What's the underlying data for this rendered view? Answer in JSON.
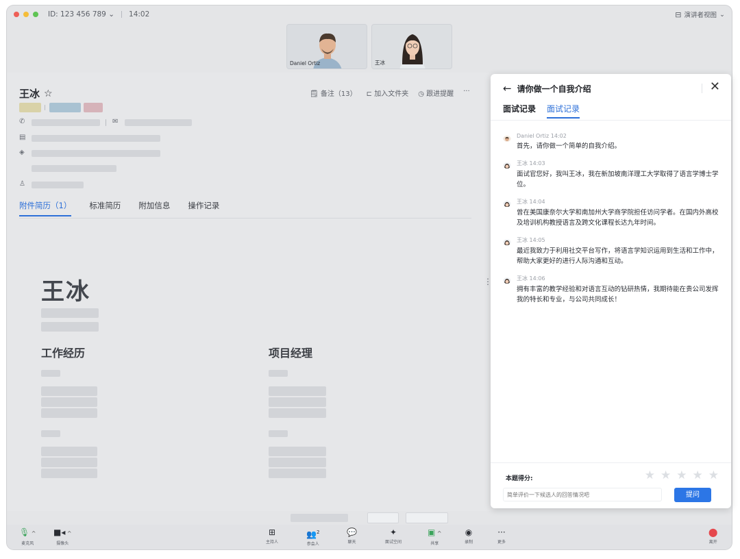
{
  "topbar": {
    "meeting_id": "ID: 123 456 789",
    "time": "14:02",
    "view_mode": "演讲者视图"
  },
  "videos": [
    {
      "name": "Daniel Ortiz"
    },
    {
      "name": "王冰"
    }
  ],
  "candidate": {
    "name": "王冰",
    "actions": {
      "notes": "备注（13）",
      "add_folder": "加入文件夹",
      "follow_up": "跟进提醒",
      "more": "···"
    },
    "tabs": [
      "附件简历（1）",
      "标准简历",
      "附加信息",
      "操作记录"
    ],
    "resume": {
      "name": "王冰",
      "section_work": "工作经历",
      "section_project": "项目经理"
    }
  },
  "drawer": {
    "title": "请你做一个自我介绍",
    "tabs": [
      "面试记录",
      "面试记录"
    ],
    "messages": [
      {
        "author": "Daniel Ortiz 14:02",
        "text": "首先，请你做一个简单的自我介绍。",
        "avatar": "daniel"
      },
      {
        "author": "王冰 14:03",
        "text": "面试官您好，我叫王冰，我在新加坡南洋理工大学取得了语言学博士学位。",
        "avatar": "wangbing"
      },
      {
        "author": "王冰 14:04",
        "text": "曾在美国康奈尔大学和南加州大学商学院担任访问学者。在国内外高校及培训机构教授语言及跨文化课程长达九年时间。",
        "avatar": "wangbing"
      },
      {
        "author": "王冰 14:05",
        "text": "最近我致力于利用社交平台写作，将语言学知识运用到生活和工作中，帮助大家更好的进行人际沟通和互动。",
        "avatar": "wangbing"
      },
      {
        "author": "王冰 14:06",
        "text": "拥有丰富的教学经验和对语言互动的钻研热情，我期待能在贵公司发挥我的特长和专业，与公司共同成长！",
        "avatar": "wangbing"
      }
    ],
    "score_label": "本题得分:",
    "stars": 0,
    "eval_placeholder": "简单评价一下候选人的回答情况吧",
    "ask_button": "提问"
  },
  "toolbar": {
    "mic": "麦克风",
    "camera": "摄像头",
    "host": "主持人",
    "participants": "参会人",
    "participants_count": "2",
    "chat": "聊天",
    "interview_space": "面试空间",
    "share": "共享",
    "record": "录制",
    "more": "更多",
    "leave": "离开"
  },
  "colors": {
    "accent": "#2c6fd8",
    "leave": "#e5484d",
    "tag_yellow": "#e6dca8",
    "tag_blue": "#aacbe0",
    "tag_pink": "#e5b8bf"
  }
}
